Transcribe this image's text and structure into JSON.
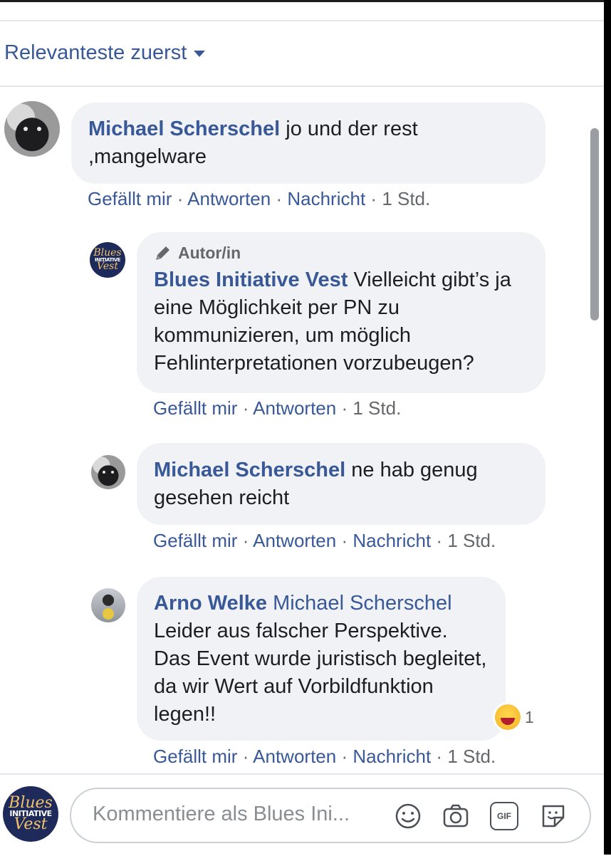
{
  "sort": {
    "label": "Relevanteste zuerst"
  },
  "comments": [
    {
      "author": "Michael Scherschel",
      "text": "jo und der rest ,mangelware",
      "actions": [
        "Gefällt mir",
        "Antworten",
        "Nachricht"
      ],
      "time": "1 Std."
    },
    {
      "badge": "Autor/in",
      "author": "Blues Initiative Vest",
      "text": "Vielleicht gibt’s ja eine Möglichkeit per PN zu kommunizieren, um möglich Fehlinterpretationen vorzubeugen?",
      "actions": [
        "Gefällt mir",
        "Antworten"
      ],
      "time": "1 Std."
    },
    {
      "author": "Michael Scherschel",
      "text": "ne hab genug gesehen reicht",
      "actions": [
        "Gefällt mir",
        "Antworten",
        "Nachricht"
      ],
      "time": "1 Std."
    },
    {
      "author": "Arno Welke",
      "mention": "Michael Scherschel",
      "text": "Leider aus falscher Perspektive. Das Event wurde juristisch begleitet, da wir Wert auf Vorbildfunktion legen!!",
      "actions": [
        "Gefällt mir",
        "Antworten",
        "Nachricht"
      ],
      "time": "1 Std.",
      "reaction_count": "1"
    }
  ],
  "avatar_text": {
    "line1": "Blues",
    "line2": "INITIATIVE",
    "line3": "Vest"
  },
  "composer": {
    "placeholder": "Kommentiere als Blues Ini...",
    "gif_label": "GIF"
  },
  "colors": {
    "link": "#385898",
    "bubble": "#f0f2f5",
    "meta_gray": "#65676b"
  }
}
